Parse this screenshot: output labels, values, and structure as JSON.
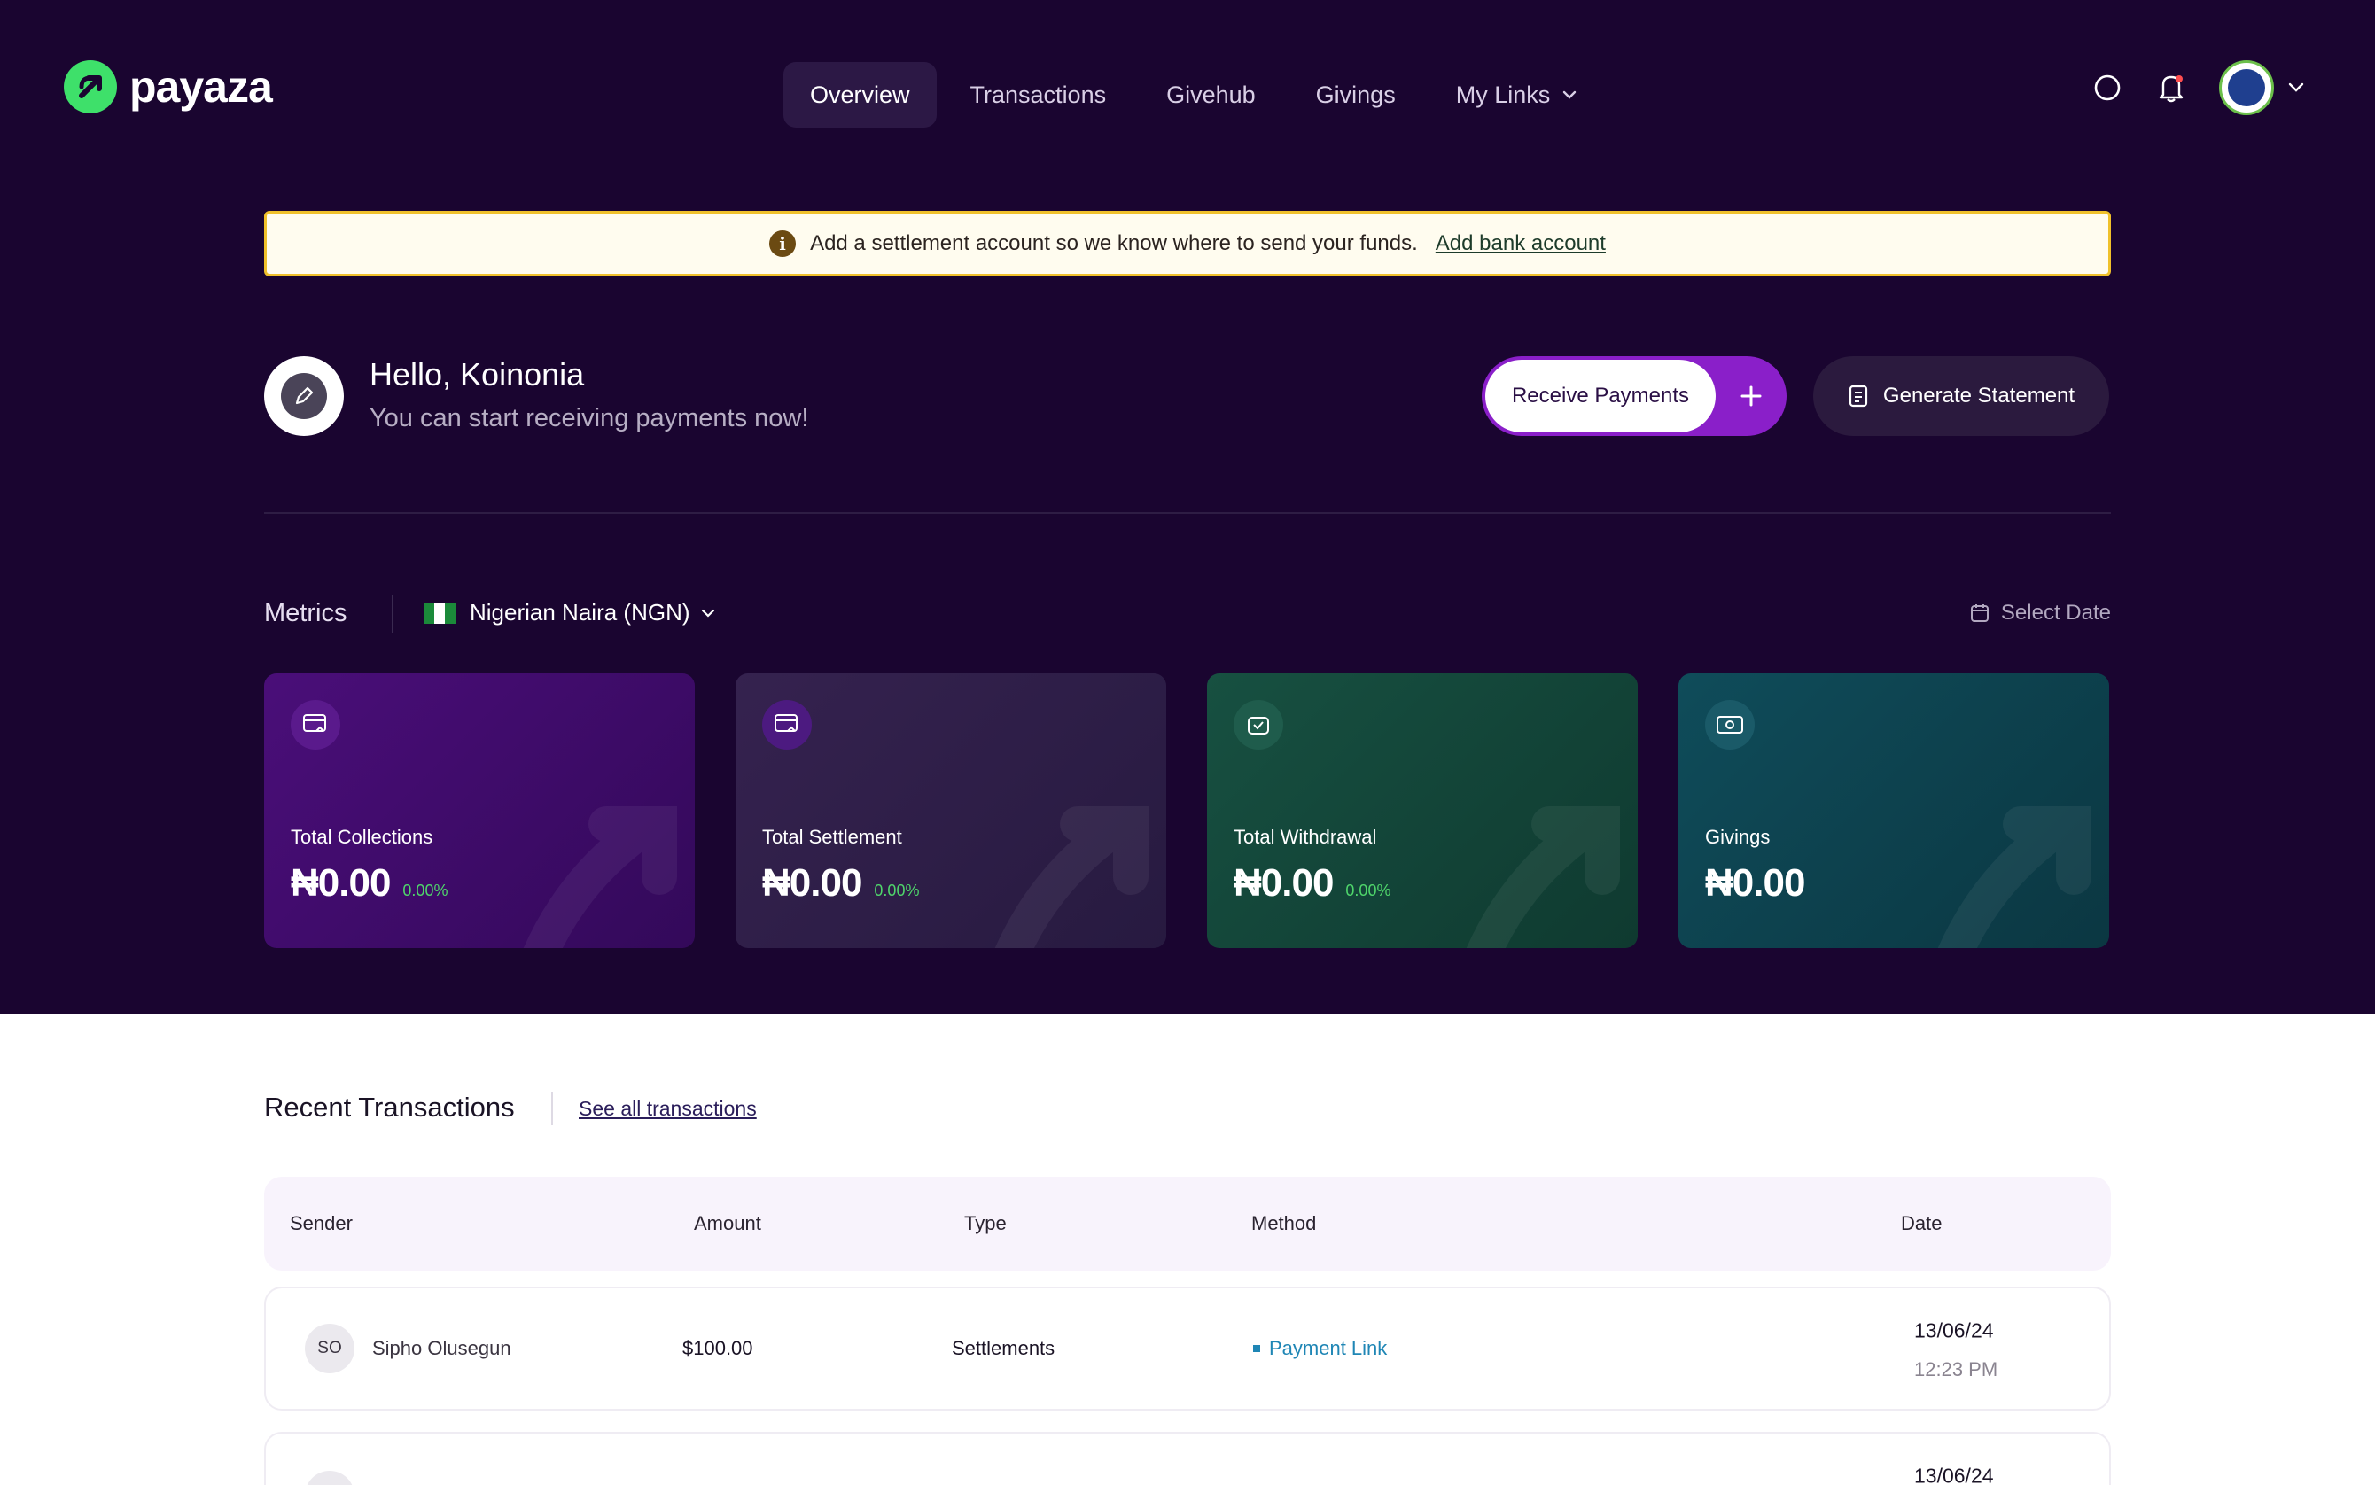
{
  "app": {
    "brand": "payaza"
  },
  "nav": {
    "items": [
      {
        "label": "Overview",
        "active": true
      },
      {
        "label": "Transactions"
      },
      {
        "label": "Givehub"
      },
      {
        "label": "Givings"
      },
      {
        "label": "My Links"
      }
    ]
  },
  "header_icons": [
    "search-icon",
    "bell-icon",
    "avatar",
    "chevron-down-icon"
  ],
  "banner": {
    "message": "Add a settlement account so we know where to send your funds.",
    "link": "Add bank account"
  },
  "greeting": {
    "title": "Hello, Koinonia",
    "subtitle": "You can start receiving payments now!"
  },
  "actions": {
    "receive_payments": "Receive Payments",
    "generate_statement": "Generate Statement"
  },
  "metrics": {
    "label": "Metrics",
    "currency": "Nigerian Naira (NGN)",
    "select_date": "Select Date",
    "cards": [
      {
        "label": "Total Collections",
        "value": "₦0.00",
        "change": "0.00%"
      },
      {
        "label": "Total Settlement",
        "value": "₦0.00",
        "change": "0.00%"
      },
      {
        "label": "Total Withdrawal",
        "value": "₦0.00",
        "change": "0.00%"
      },
      {
        "label": "Givings",
        "value": "₦0.00"
      }
    ]
  },
  "recent": {
    "title": "Recent Transactions",
    "see_all": "See all transactions",
    "columns": {
      "sender": "Sender",
      "amount": "Amount",
      "type": "Type",
      "method": "Method",
      "date": "Date"
    },
    "rows": [
      {
        "initials": "SO",
        "sender": "Sipho Olusegun",
        "amount": "$100.00",
        "type": "Settlements",
        "method": "Payment Link",
        "date": "13/06/24",
        "time": "12:23 PM"
      },
      {
        "date": "13/06/24"
      }
    ]
  },
  "colors": {
    "hero_bg": "#1a0530",
    "accent_purple": "#8a1fc9",
    "brand_green": "#3ee06a",
    "banner_border": "#f0c12b",
    "positive": "#4fd66b",
    "method_link": "#1f86b5"
  }
}
